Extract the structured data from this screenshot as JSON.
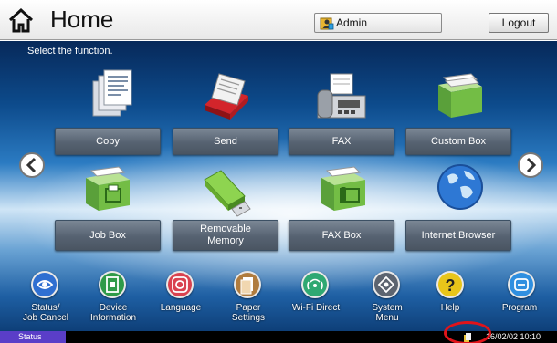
{
  "header": {
    "title": "Home",
    "home_icon": "home-icon",
    "user_label": "Admin",
    "user_icon": "admin-user-icon",
    "logout_label": "Logout"
  },
  "main": {
    "prompt": "Select the function.",
    "functions": [
      {
        "label": "Copy",
        "icon": "copy-icon"
      },
      {
        "label": "Send",
        "icon": "send-icon"
      },
      {
        "label": "FAX",
        "icon": "fax-icon"
      },
      {
        "label": "Custom Box",
        "icon": "custom-box-icon"
      },
      {
        "label": "Job Box",
        "icon": "job-box-icon"
      },
      {
        "label": "Removable Memory",
        "icon": "usb-memory-icon"
      },
      {
        "label": "FAX Box",
        "icon": "fax-box-icon"
      },
      {
        "label": "Internet Browser",
        "icon": "globe-icon"
      }
    ],
    "prev_icon": "chevron-left-icon",
    "next_icon": "chevron-right-icon"
  },
  "toolbar": [
    {
      "label": "Status/\nJob Cancel",
      "icon": "status-icon",
      "color": "#2f6fd1"
    },
    {
      "label": "Device\nInformation",
      "icon": "device-info-icon",
      "color": "#2f9a48"
    },
    {
      "label": "Language",
      "icon": "language-icon",
      "color": "#d9424f"
    },
    {
      "label": "Paper\nSettings",
      "icon": "paper-icon",
      "color": "#b07c3e"
    },
    {
      "label": "Wi-Fi Direct",
      "icon": "wifi-icon",
      "color": "#2fa872"
    },
    {
      "label": "System\nMenu",
      "icon": "system-menu-icon",
      "color": "#5c6470"
    },
    {
      "label": "Help",
      "icon": "help-icon",
      "color": "#e8c51a"
    },
    {
      "label": "Program",
      "icon": "program-icon",
      "color": "#2f8fe0"
    }
  ],
  "statusbar": {
    "status_label": "Status",
    "datetime": "16/02/02  10:10"
  }
}
